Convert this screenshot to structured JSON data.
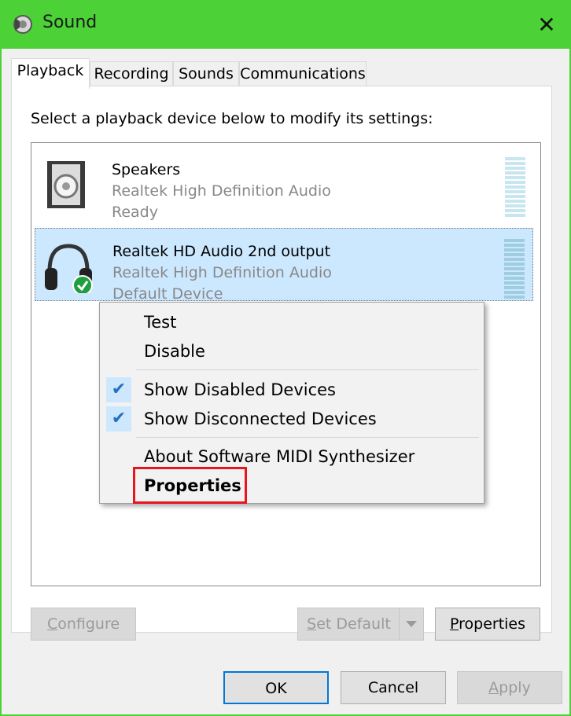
{
  "window": {
    "title": "Sound",
    "close_glyph": "✕"
  },
  "tabs": [
    {
      "label": "Playback",
      "active": true
    },
    {
      "label": "Recording",
      "active": false
    },
    {
      "label": "Sounds",
      "active": false
    },
    {
      "label": "Communications",
      "active": false
    }
  ],
  "playback": {
    "instruction": "Select a playback device below to modify its settings:",
    "devices": [
      {
        "name": "Speakers",
        "driver": "Realtek High Definition Audio",
        "status": "Ready",
        "icon": "speaker-icon",
        "selected": false
      },
      {
        "name": "Realtek HD Audio 2nd output",
        "driver": "Realtek High Definition Audio",
        "status": "Default Device",
        "icon": "headphones-icon",
        "selected": true
      }
    ]
  },
  "context_menu": {
    "items": [
      {
        "label": "Test",
        "checked": false
      },
      {
        "label": "Disable",
        "checked": false
      },
      {
        "label": "Show Disabled Devices",
        "checked": true
      },
      {
        "label": "Show Disconnected Devices",
        "checked": true
      },
      {
        "label": "About Software MIDI Synthesizer",
        "checked": false
      },
      {
        "label": "Properties",
        "checked": false,
        "bold": true
      }
    ],
    "check_glyph": "✔"
  },
  "buttons": {
    "configure": {
      "label": "Configure",
      "accel": "C",
      "rest": "onfigure",
      "enabled": false
    },
    "set_default": {
      "label": "Set Default",
      "accel": "S",
      "rest": "et Default",
      "enabled": false
    },
    "properties": {
      "label": "Properties",
      "accel": "P",
      "rest": "roperties",
      "enabled": true
    },
    "ok": {
      "label": "OK",
      "enabled": true
    },
    "cancel": {
      "label": "Cancel",
      "enabled": true
    },
    "apply": {
      "label": "Apply",
      "accel": "A",
      "rest": "pply",
      "enabled": false
    }
  },
  "colors": {
    "title_bar": "#4cd137",
    "selection": "#cce8ff",
    "highlight_box": "#e8141e",
    "default_button_border": "#0078d7"
  }
}
